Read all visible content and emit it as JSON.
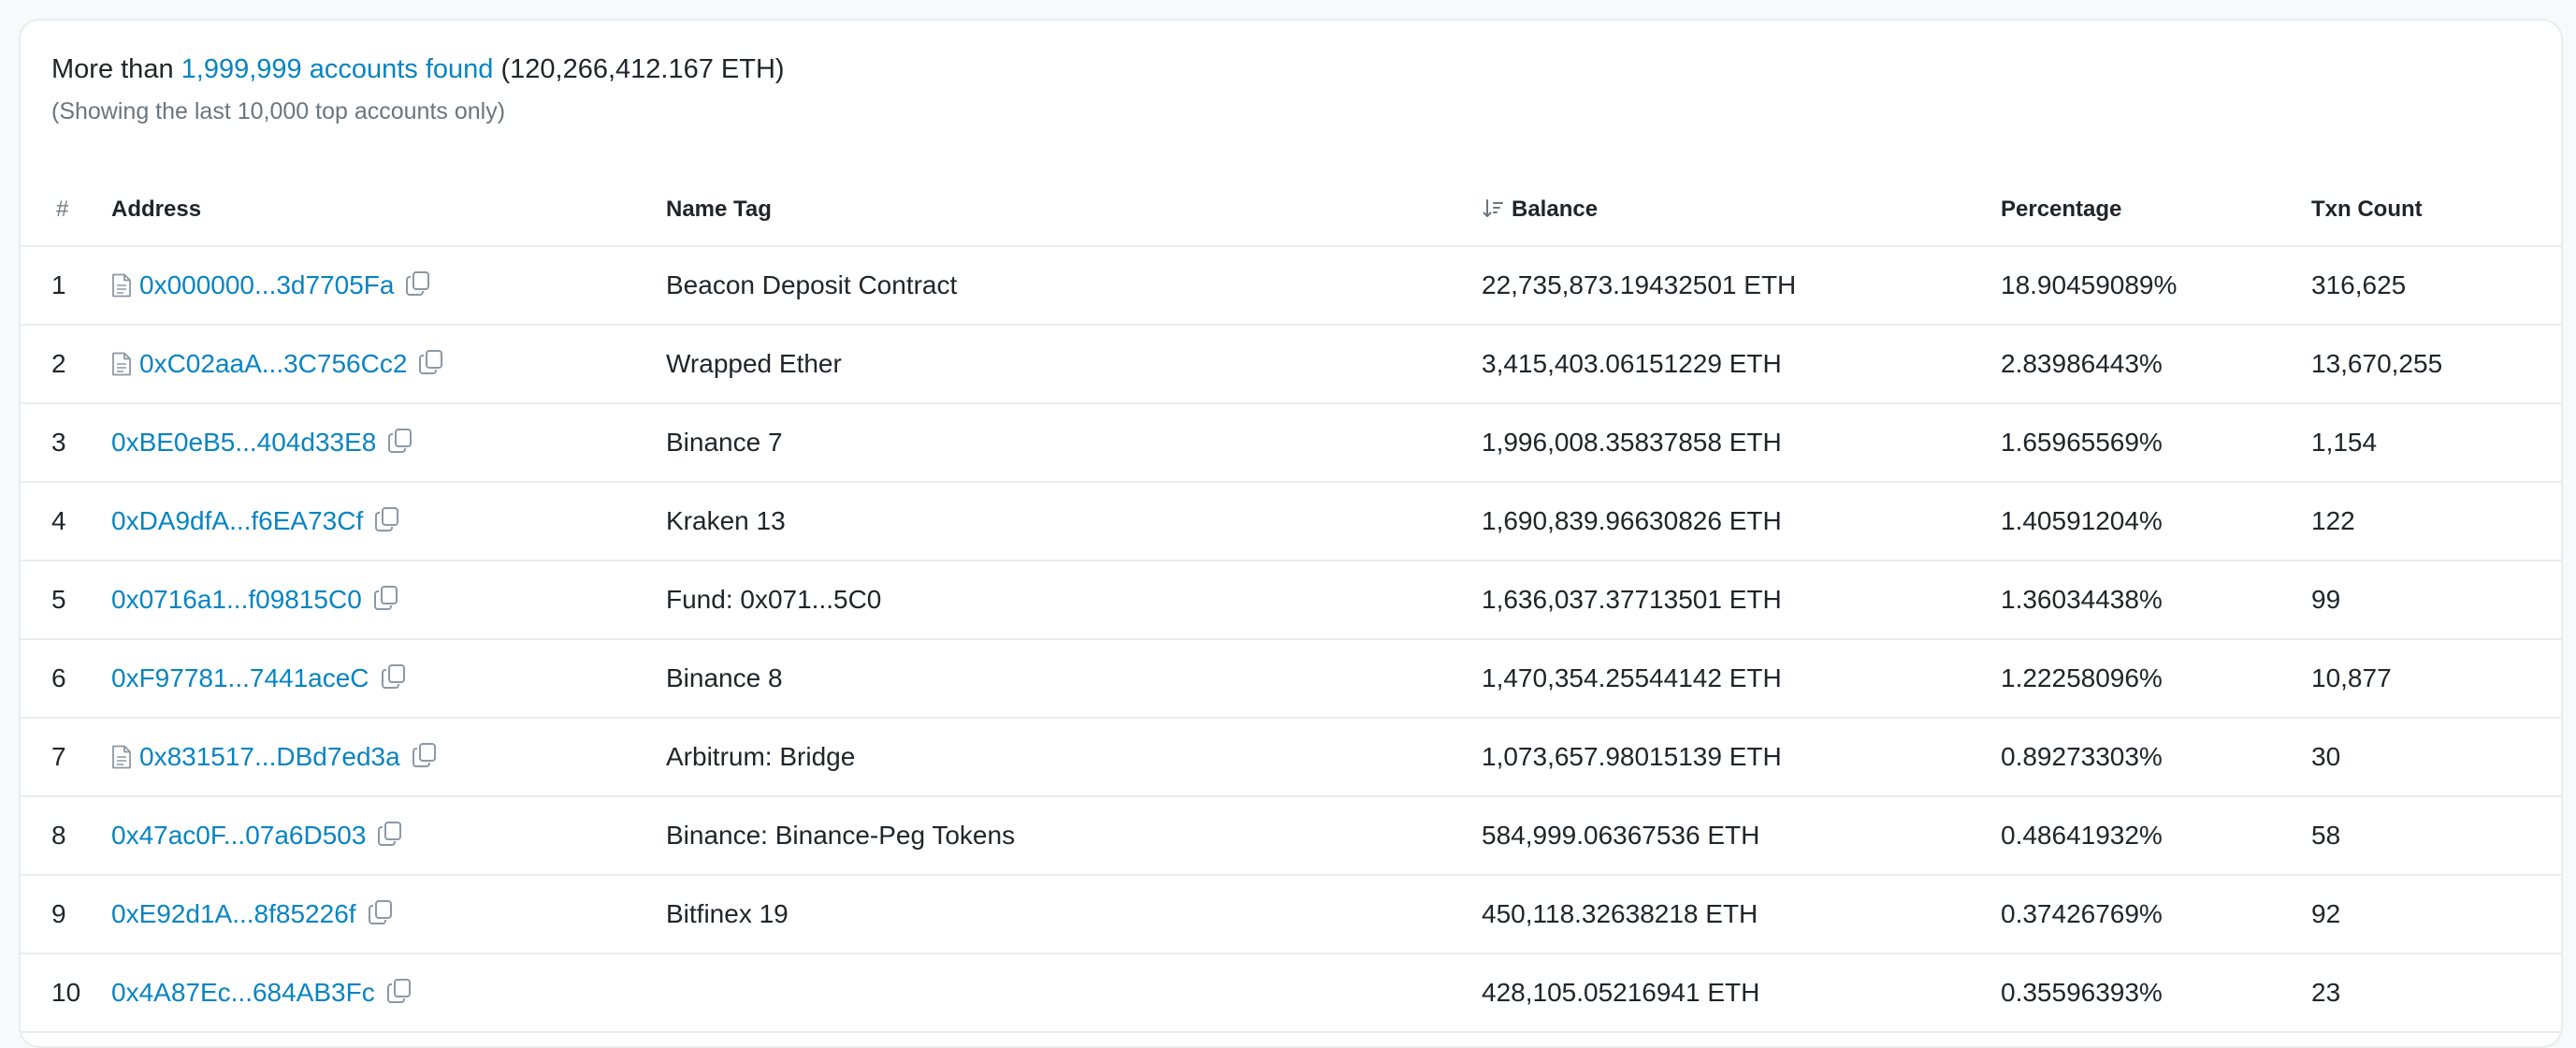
{
  "summary": {
    "prefix": "More than",
    "accounts_link": "1,999,999 accounts found",
    "total": "(120,266,412.167 ETH)",
    "note": "(Showing the last 10,000 top accounts only)"
  },
  "columns": {
    "rank": "#",
    "address": "Address",
    "name_tag": "Name Tag",
    "balance": "Balance",
    "percentage": "Percentage",
    "txn_count": "Txn Count"
  },
  "rows": [
    {
      "rank": "1",
      "address": "0x000000...3d7705Fa",
      "contract": true,
      "name_tag": "Beacon Deposit Contract",
      "balance": "22,735,873.19432501 ETH",
      "percentage": "18.90459089%",
      "txn_count": "316,625"
    },
    {
      "rank": "2",
      "address": "0xC02aaA...3C756Cc2",
      "contract": true,
      "name_tag": "Wrapped Ether",
      "balance": "3,415,403.06151229 ETH",
      "percentage": "2.83986443%",
      "txn_count": "13,670,255"
    },
    {
      "rank": "3",
      "address": "0xBE0eB5...404d33E8",
      "contract": false,
      "name_tag": "Binance 7",
      "balance": "1,996,008.35837858 ETH",
      "percentage": "1.65965569%",
      "txn_count": "1,154"
    },
    {
      "rank": "4",
      "address": "0xDA9dfA...f6EA73Cf",
      "contract": false,
      "name_tag": "Kraken 13",
      "balance": "1,690,839.96630826 ETH",
      "percentage": "1.40591204%",
      "txn_count": "122"
    },
    {
      "rank": "5",
      "address": "0x0716a1...f09815C0",
      "contract": false,
      "name_tag": "Fund: 0x071...5C0",
      "balance": "1,636,037.37713501 ETH",
      "percentage": "1.36034438%",
      "txn_count": "99"
    },
    {
      "rank": "6",
      "address": "0xF97781...7441aceC",
      "contract": false,
      "name_tag": "Binance 8",
      "balance": "1,470,354.25544142 ETH",
      "percentage": "1.22258096%",
      "txn_count": "10,877"
    },
    {
      "rank": "7",
      "address": "0x831517...DBd7ed3a",
      "contract": true,
      "name_tag": "Arbitrum: Bridge",
      "balance": "1,073,657.98015139 ETH",
      "percentage": "0.89273303%",
      "txn_count": "30"
    },
    {
      "rank": "8",
      "address": "0x47ac0F...07a6D503",
      "contract": false,
      "name_tag": "Binance: Binance-Peg Tokens",
      "balance": "584,999.06367536 ETH",
      "percentage": "0.48641932%",
      "txn_count": "58"
    },
    {
      "rank": "9",
      "address": "0xE92d1A...8f85226f",
      "contract": false,
      "name_tag": "Bitfinex 19",
      "balance": "450,118.32638218 ETH",
      "percentage": "0.37426769%",
      "txn_count": "92"
    },
    {
      "rank": "10",
      "address": "0x4A87Ec...684AB3Fc",
      "contract": false,
      "name_tag": "",
      "balance": "428,105.05216941 ETH",
      "percentage": "0.35596393%",
      "txn_count": "23"
    }
  ],
  "icons": {
    "contract": "file-document-icon",
    "copy": "copy-icon",
    "sort": "sort-descending-icon"
  },
  "colors": {
    "link": "#0784c3",
    "muted": "#6c757d",
    "border": "#e9ecef"
  }
}
